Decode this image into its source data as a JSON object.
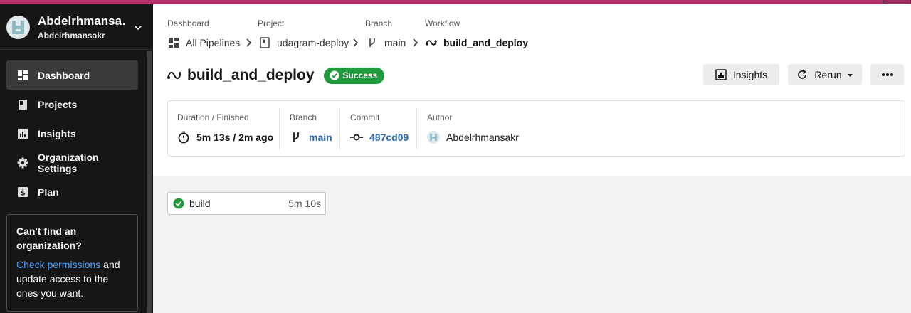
{
  "sidebar": {
    "user": {
      "name": "Abdelrhmansa…",
      "org": "Abdelrhmansakr"
    },
    "nav": [
      {
        "label": "Dashboard",
        "icon": "dashboard-icon",
        "active": true
      },
      {
        "label": "Projects",
        "icon": "projects-icon"
      },
      {
        "label": "Insights",
        "icon": "insights-icon"
      },
      {
        "label": "Organization Settings",
        "icon": "gear-icon"
      },
      {
        "label": "Plan",
        "icon": "dollar-icon"
      }
    ],
    "help": {
      "title": "Can't find an organization?",
      "link": "Check permissions",
      "body": " and update access to the ones you want."
    }
  },
  "breadcrumb": {
    "labels": {
      "dashboard": "Dashboard",
      "project": "Project",
      "branch": "Branch",
      "workflow": "Workflow"
    },
    "items": {
      "pipelines": "All Pipelines",
      "project": "udagram-deploy",
      "branch": "main",
      "workflow": "build_and_deploy"
    }
  },
  "workflow": {
    "title": "build_and_deploy",
    "status": "Success",
    "status_color": "#1f9a3c"
  },
  "actions": {
    "insights": "Insights",
    "rerun": "Rerun"
  },
  "info": {
    "duration": {
      "label": "Duration / Finished",
      "value": "5m 13s / 2m ago"
    },
    "branch": {
      "label": "Branch",
      "value": "main"
    },
    "commit": {
      "label": "Commit",
      "value": "487cd09"
    },
    "author": {
      "label": "Author",
      "value": "Abdelrhmansakr"
    }
  },
  "jobs": [
    {
      "name": "build",
      "duration": "5m 10s",
      "status": "success"
    }
  ],
  "colors": {
    "link": "#2c6ab2",
    "help_link": "#4aa3ff",
    "sidebar_bg": "#161616"
  }
}
